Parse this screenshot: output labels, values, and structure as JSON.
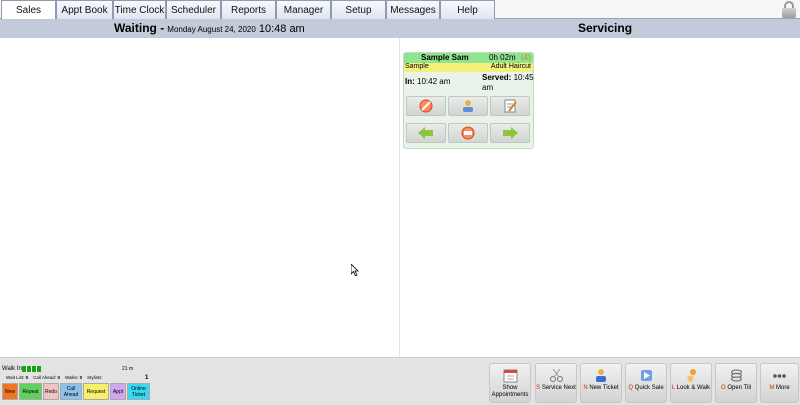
{
  "nav": {
    "tabs": [
      {
        "label": "Sales"
      },
      {
        "label": "Appt Book"
      },
      {
        "label": "Time Clock"
      },
      {
        "label": "Scheduler"
      },
      {
        "label": "Reports"
      },
      {
        "label": "Manager"
      },
      {
        "label": "Setup"
      },
      {
        "label": "Messages"
      },
      {
        "label": "Help"
      }
    ],
    "active_tab": "Sales"
  },
  "header": {
    "waiting_label": "Waiting -",
    "date": "Monday August 24, 2020",
    "time": "10:48 am",
    "servicing_label": "Servicing"
  },
  "ticket": {
    "client_name": "Sample Sam",
    "duration": "0h 02m",
    "count": "(4)",
    "stylist": "Sample",
    "service": "Adult Haircut",
    "in_label": "In:",
    "in_time": "10:42 am",
    "served_label": "Served:",
    "served_time": "10:45 am"
  },
  "waitlist": {
    "walk_in_label": "Walk In",
    "minutes": "21 m",
    "wait_list_label": "Wait List:",
    "wait_list_count": "0",
    "call_ahead_label": "Call Ahead:",
    "call_ahead_count": "0",
    "walks_label": "Walks:",
    "walks_count": "0",
    "stylists_label": "Stylists:",
    "stylists_count": "1",
    "buttons": [
      {
        "label": "New",
        "color": "#f0751e"
      },
      {
        "label": "Repeat",
        "color": "#5ed15e"
      },
      {
        "label": "Redo",
        "color": "#f2c3c3"
      },
      {
        "label": "Call Ahead",
        "color": "#8fc1ef"
      },
      {
        "label": "Request",
        "color": "#f7f06a"
      },
      {
        "label": "Appt",
        "color": "#d1a7f2"
      },
      {
        "label": "Online Ticket",
        "color": "#37d8f2"
      }
    ]
  },
  "actions": [
    {
      "key": "",
      "label": "Show Appointments",
      "icon": "calendar-icon"
    },
    {
      "key": "S",
      "label": "Service Next",
      "icon": "scissors-icon"
    },
    {
      "key": "N",
      "label": "New Ticket",
      "icon": "person-ticket-icon"
    },
    {
      "key": "Q",
      "label": "Quick Sale",
      "icon": "quick-sale-icon"
    },
    {
      "key": "L",
      "label": "Look & Walk",
      "icon": "look-walk-icon"
    },
    {
      "key": "O",
      "label": "Open Till",
      "icon": "coins-icon"
    },
    {
      "key": "M",
      "label": "More",
      "icon": "more-dots-icon"
    }
  ],
  "colors": {
    "header_bar": "#c3cad9",
    "ticket_header": "#8fe58f",
    "ticket_service": "#f4f07c",
    "card_bg": "#e9f3ea"
  }
}
